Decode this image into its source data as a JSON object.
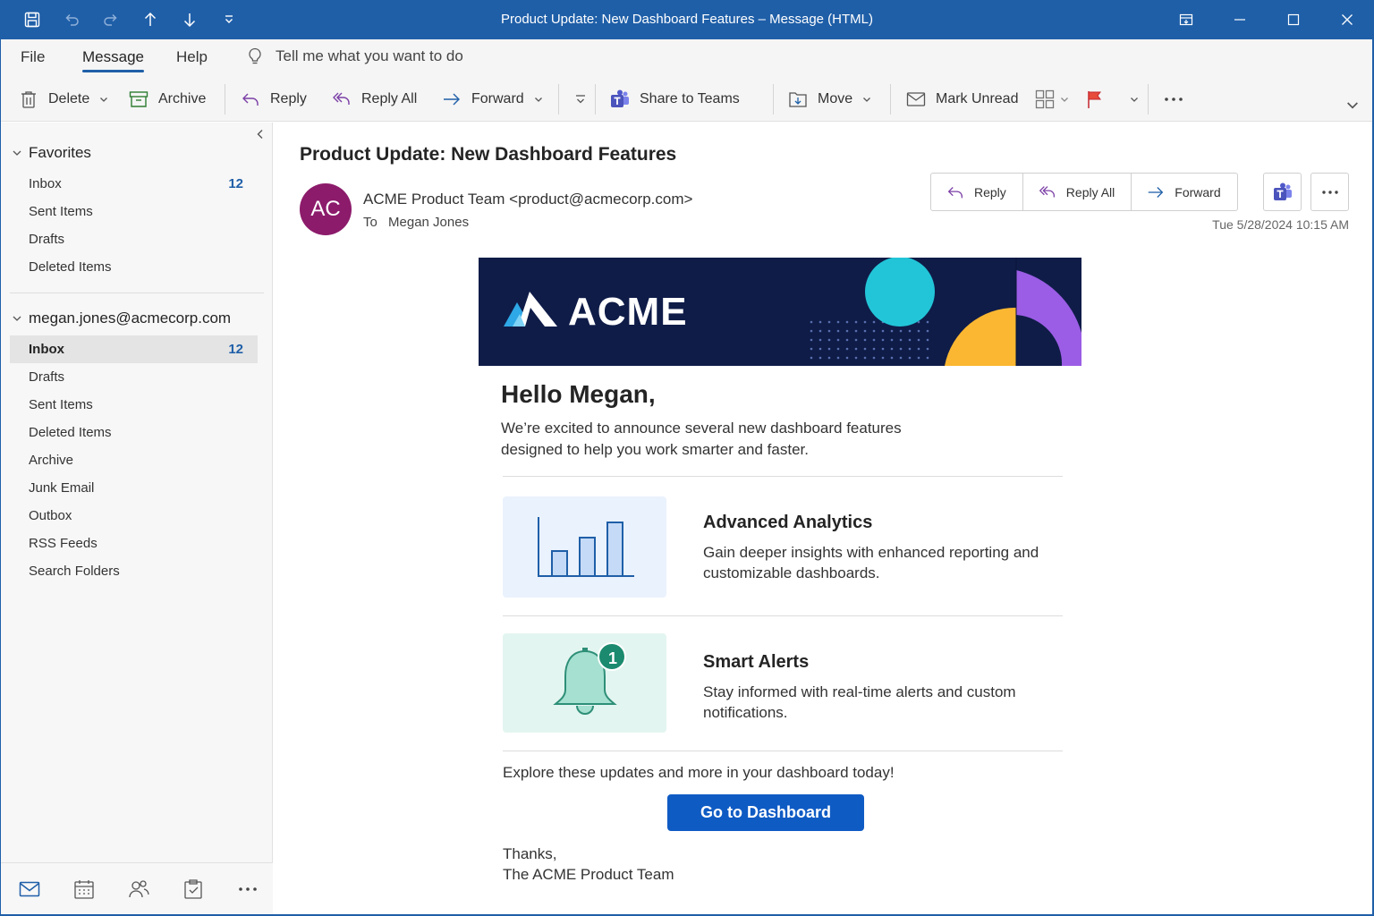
{
  "window": {
    "title": "Product Update: New Dashboard Features – Message (HTML)"
  },
  "menu": {
    "tabs": [
      "File",
      "Message",
      "Help"
    ],
    "active": "Message",
    "tell_me": "Tell me what you want to do"
  },
  "ribbon": {
    "delete": "Delete",
    "archive": "Archive",
    "reply": "Reply",
    "reply_all": "Reply All",
    "forward": "Forward",
    "share_teams": "Share to Teams",
    "move": "Move",
    "mark_unread": "Mark Unread"
  },
  "sidebar": {
    "favorites": {
      "label": "Favorites",
      "items": [
        {
          "label": "Inbox",
          "count": "12"
        },
        {
          "label": "Sent Items"
        },
        {
          "label": "Drafts"
        },
        {
          "label": "Deleted Items"
        }
      ]
    },
    "account": {
      "label": "megan.jones@acmecorp.com",
      "items": [
        {
          "label": "Inbox",
          "count": "12",
          "selected": true
        },
        {
          "label": "Drafts"
        },
        {
          "label": "Sent Items"
        },
        {
          "label": "Deleted Items"
        },
        {
          "label": "Archive"
        },
        {
          "label": "Junk Email"
        },
        {
          "label": "Outbox"
        },
        {
          "label": "RSS Feeds"
        },
        {
          "label": "Search Folders"
        }
      ]
    }
  },
  "message": {
    "subject": "Product Update: New Dashboard Features",
    "avatar_initials": "AC",
    "avatar_color": "#8c1b6b",
    "sender": "ACME Product Team <product@acmecorp.com>",
    "to_label": "To",
    "to": "Megan Jones",
    "datetime": "Tue 5/28/2024 10:15 AM",
    "actions": {
      "reply": "Reply",
      "reply_all": "Reply All",
      "forward": "Forward"
    }
  },
  "email": {
    "brand": "ACME",
    "greeting": "Hello Megan,",
    "intro": "We’re excited to announce several new dashboard features designed to help you work smarter and faster.",
    "features": [
      {
        "title": "Advanced Analytics",
        "description": "Gain deeper insights with enhanced reporting and customizable dashboards.",
        "icon": "bar-chart-icon"
      },
      {
        "title": "Smart Alerts",
        "description": "Stay informed with real-time alerts and custom notifications.",
        "icon": "bell-icon",
        "badge": "1"
      }
    ],
    "explore": "Explore these updates and more in your dashboard today!",
    "cta": "Go to Dashboard",
    "sign_off": "Thanks,",
    "signature": "The ACME Product Team"
  },
  "colors": {
    "accent": "#1f5fa8",
    "cta": "#0f5bc4",
    "banner": "#0f1c48"
  }
}
